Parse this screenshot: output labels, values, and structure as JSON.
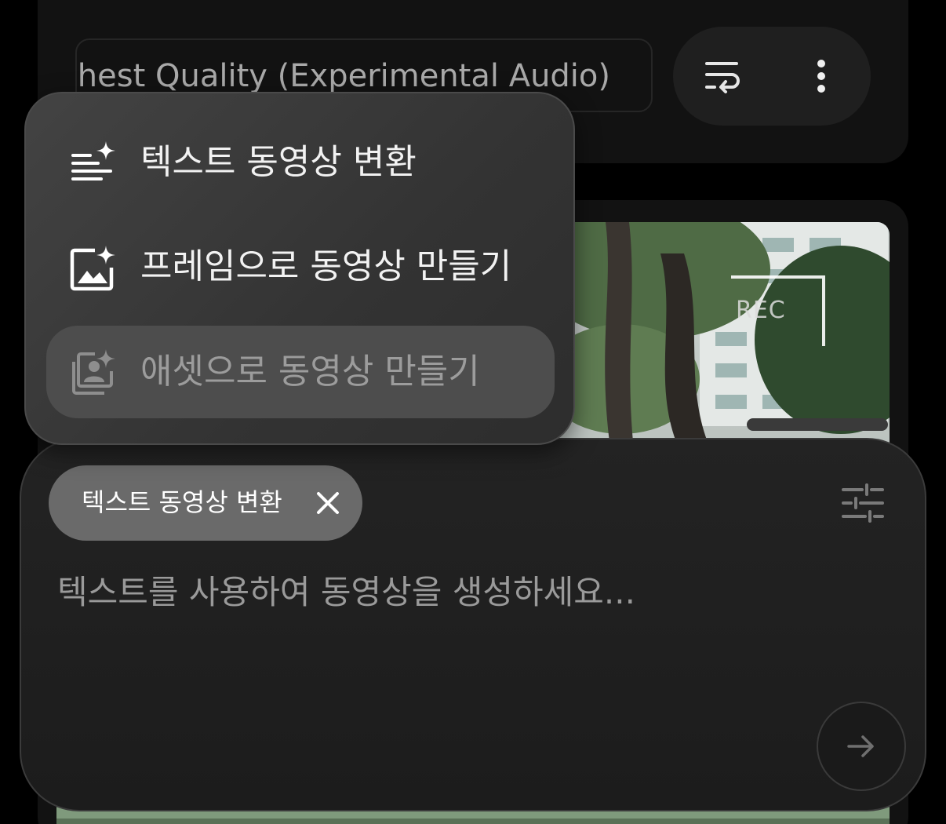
{
  "top_bar": {
    "model_selector_value": "Highest Quality (Experimental Audio)",
    "wrap_icon": "wrap-text-icon",
    "more_icon": "more-vert-icon"
  },
  "video": {
    "overlay_text": "REC"
  },
  "mode_menu": {
    "items": [
      {
        "label": "텍스트 동영상 변환",
        "icon": "text-sparkle-icon"
      },
      {
        "label": "프레임으로 동영상 만들기",
        "icon": "image-sparkle-icon"
      },
      {
        "label": "애셋으로 동영상 만들기",
        "icon": "assets-sparkle-icon"
      }
    ]
  },
  "composer": {
    "chip_label": "텍스트 동영상 변환",
    "chip_close_icon": "close-icon",
    "settings_icon": "tune-icon",
    "prompt_placeholder": "텍스트를 사용하여 동영상을 생성하세요...",
    "send_icon": "arrow-right-icon"
  },
  "colors": {
    "background": "#000000",
    "menu": "#3a3a3a",
    "chip": "#6a6a6a",
    "text": "#f2f2f2"
  }
}
